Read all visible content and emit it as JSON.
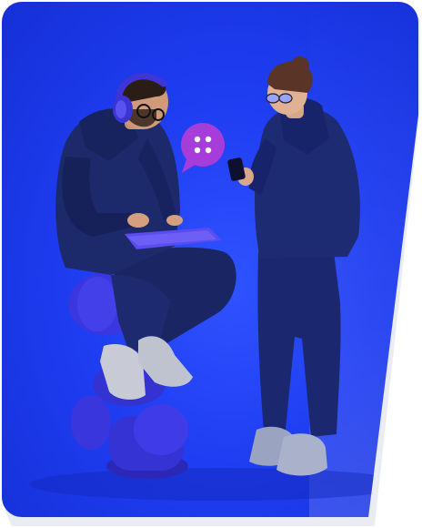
{
  "scene": {
    "description_hidden": false,
    "background": "#1f3df2",
    "accent_bubble": "#a43bd6",
    "outfit": "#1c2a6b",
    "seat": "#3a36d8",
    "sneakers": "#c9ccd6"
  },
  "icons": {
    "chat_bubble": "chat-bubble-icon"
  }
}
